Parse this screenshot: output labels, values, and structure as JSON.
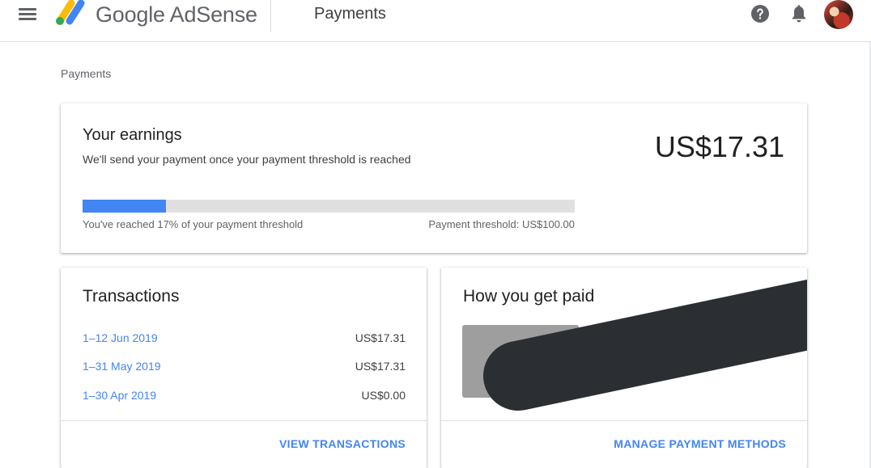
{
  "header": {
    "logo_text": "Google AdSense",
    "page_title": "Payments",
    "icons": [
      "menu-icon",
      "adsense-logo-icon",
      "help-icon",
      "bell-icon",
      "avatar"
    ]
  },
  "breadcrumb": "Payments",
  "earnings": {
    "title": "Your earnings",
    "subtitle": "We'll send your payment once your payment threshold is reached",
    "amount": "US$17.31",
    "progress_fraction": 0.17,
    "progress_label": "You've reached 17% of your payment threshold",
    "threshold_label": "Payment threshold: US$100.00"
  },
  "transactions": {
    "title": "Transactions",
    "rows": [
      {
        "date": "1–12 Jun 2019",
        "amount": "US$17.31"
      },
      {
        "date": "1–31 May 2019",
        "amount": "US$17.31"
      },
      {
        "date": "1–30 Apr 2019",
        "amount": "US$0.00"
      }
    ],
    "action": "VIEW TRANSACTIONS"
  },
  "payment_method": {
    "title": "How you get paid",
    "action": "MANAGE PAYMENT METHODS"
  },
  "colors": {
    "accent": "#4285f4",
    "progress_track": "#e0e0e0",
    "redaction": "#2b2f33",
    "logo_yellow": "#fbbc04",
    "logo_blue": "#4285f4",
    "logo_green": "#34a853"
  }
}
